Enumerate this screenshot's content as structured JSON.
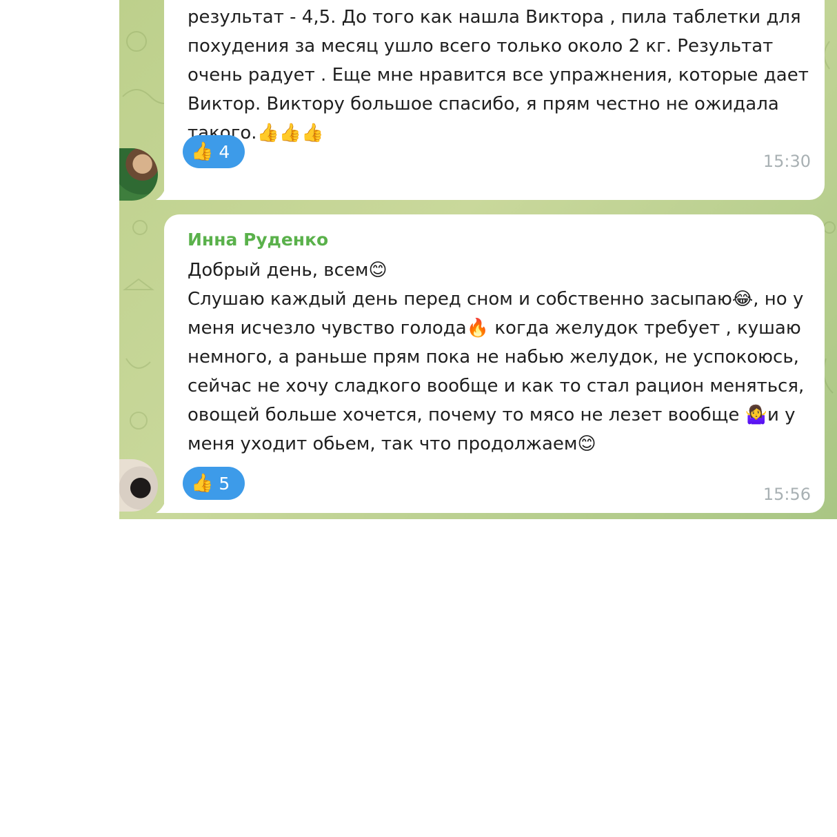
{
  "messages": [
    {
      "sender": "",
      "lines": [
        "результат  - 4,5. До того как нашла Виктора , пила таблетки для",
        "похудения за месяц ушло всего только около 2 кг. Результат",
        "очень радует . Еще мне нравится все упражнения,  которые дает",
        "Виктор. Виктору большое спасибо, я прям честно не ожидала",
        "такого.👍👍👍"
      ],
      "reaction": {
        "emoji": "👍",
        "count": "4"
      },
      "time": "15:30"
    },
    {
      "sender": "Инна Руденко",
      "lines": [
        "Добрый день, всем😊",
        "Слушаю каждый день перед сном и собственно засыпаю😂, но у",
        "меня исчезло чувство голода🔥 когда желудок требует , кушаю",
        "немного, а раньше прям пока не набью желудок, не успокоюсь,",
        "сейчас не хочу сладкого вообще и как то стал рацион меняться,",
        "овощей больше хочется, почему то мясо не лезет вообще 🤷‍♀️и у",
        "меня уходит обьем, так что продолжаем😊"
      ],
      "reaction": {
        "emoji": "👍",
        "count": "5"
      },
      "time": "15:56"
    }
  ],
  "colors": {
    "chat_background": "#bdd08c",
    "bubble": "#ffffff",
    "sender_name": "#5ab14b",
    "reaction_pill": "#3d9be9",
    "timestamp": "#a8b0b3"
  },
  "icons": {
    "avatar_1": "avatar-photo-woman",
    "avatar_2": "avatar-photo-cat"
  }
}
